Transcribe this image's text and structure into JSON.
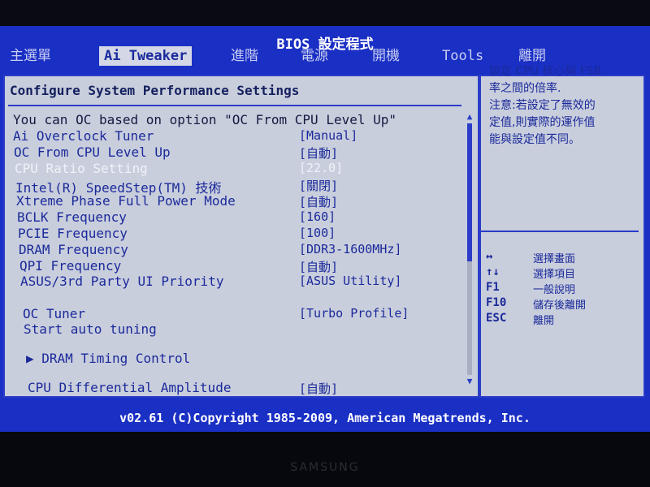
{
  "title": "BIOS 設定程式",
  "menu": [
    {
      "label": "主選單",
      "active": false
    },
    {
      "label": "Ai Tweaker",
      "active": true
    },
    {
      "label": "進階",
      "active": false
    },
    {
      "label": "電源",
      "active": false
    },
    {
      "label": "開機",
      "active": false
    },
    {
      "label": "Tools",
      "active": false
    },
    {
      "label": "離開",
      "active": false
    }
  ],
  "panel": {
    "header": "Configure System Performance Settings",
    "info": "You can OC based on option \"OC From CPU Level Up\"",
    "settings": [
      {
        "label": "Ai Overclock Tuner",
        "value": "[Manual]"
      },
      {
        "label": "OC From CPU Level Up",
        "value": "[自動]"
      },
      {
        "label": "CPU Ratio Setting",
        "value": "[22.0]",
        "selected": true
      },
      {
        "label": "Intel(R) SpeedStep(TM) 技術",
        "value": "[關閉]"
      },
      {
        "label": "Xtreme Phase Full Power Mode",
        "value": "[自動]"
      },
      {
        "label": "BCLK Frequency",
        "value": "[160]"
      },
      {
        "label": "PCIE Frequency",
        "value": "[100]"
      },
      {
        "label": "DRAM Frequency",
        "value": "[DDR3-1600MHz]"
      },
      {
        "label": "QPI Frequency",
        "value": "[自動]"
      },
      {
        "label": "ASUS/3rd Party UI Priority",
        "value": "[ASUS Utility]"
      },
      {
        "label": "OC Tuner",
        "value": "[Turbo Profile]"
      },
      {
        "label": "Start auto tuning",
        "value": ""
      },
      {
        "label": "▶ DRAM Timing Control",
        "value": ""
      },
      {
        "label": "CPU Differential Amplitude",
        "value": "[自動]"
      }
    ]
  },
  "help": {
    "lines": [
      "設定 CPU 核心與 FSB",
      "率之間的倍率.",
      "注意:若設定了無效的",
      "定值,則實際的運作值",
      "能與設定值不同。"
    ]
  },
  "keys": [
    {
      "key": "↔",
      "desc": "選擇畫面"
    },
    {
      "key": "↑↓",
      "desc": "選擇項目"
    },
    {
      "key": "F1",
      "desc": "一般說明"
    },
    {
      "key": "F10",
      "desc": "儲存後離開"
    },
    {
      "key": "ESC",
      "desc": "離開"
    }
  ],
  "copyright": "v02.61 (C)Copyright 1985-2009, American Megatrends, Inc.",
  "monitor_brand": "SAMSUNG",
  "colors": {
    "bios_blue": "#1a2fc4",
    "panel_bg": "#c9cedd",
    "text_blue": "#1b2a9a",
    "selected_text": "#f0f2f8"
  }
}
